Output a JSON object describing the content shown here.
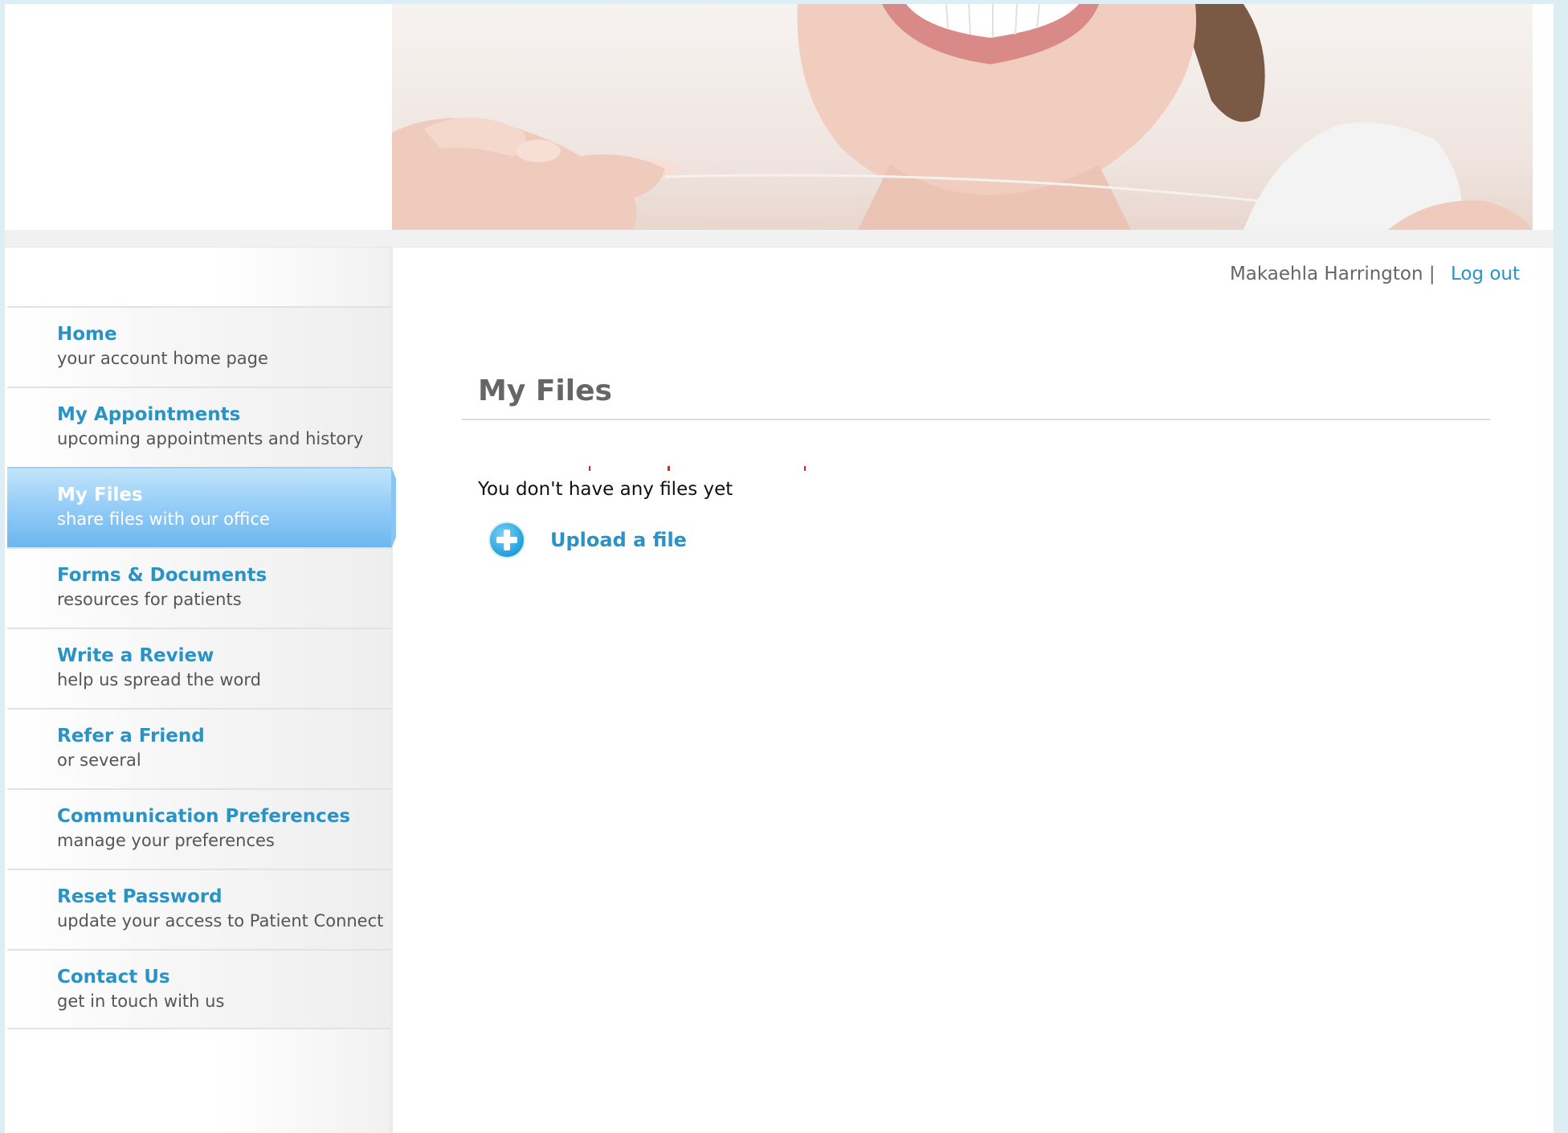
{
  "header": {
    "banner_image": "smiling-woman-flossing-teeth"
  },
  "sidebar": {
    "items": [
      {
        "title": "Home",
        "subtitle": "your account home page",
        "active": false
      },
      {
        "title": "My Appointments",
        "subtitle": "upcoming appointments and history",
        "active": false
      },
      {
        "title": "My Files",
        "subtitle": "share files with our office",
        "active": true
      },
      {
        "title": "Forms & Documents",
        "subtitle": "resources for patients",
        "active": false
      },
      {
        "title": "Write a Review",
        "subtitle": "help us spread the word",
        "active": false
      },
      {
        "title": "Refer a Friend",
        "subtitle": "or several",
        "active": false
      },
      {
        "title": "Communication Preferences",
        "subtitle": "manage your preferences",
        "active": false
      },
      {
        "title": "Reset Password",
        "subtitle": "update your access to Patient Connect",
        "active": false
      },
      {
        "title": "Contact Us",
        "subtitle": "get in touch with us",
        "active": false
      }
    ]
  },
  "user_bar": {
    "user_name": "Makaehla Harrington",
    "separator": "|",
    "logout_label": "Log out"
  },
  "main": {
    "title": "My Files",
    "empty_message": "You don't have any files yet",
    "upload_label": "Upload a file",
    "upload_icon": "plus-circle-icon"
  },
  "colors": {
    "link": "#2a93c5",
    "active_nav": "#8fcaf6",
    "background": "#dceef3"
  }
}
